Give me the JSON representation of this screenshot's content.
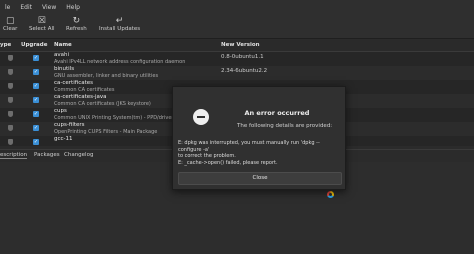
{
  "menubar": {
    "items": [
      "le",
      "Edit",
      "View",
      "Help"
    ]
  },
  "toolbar": {
    "clear_label": "Clear",
    "select_all_label": "Select All",
    "refresh_label": "Refresh",
    "install_label": "Install Updates"
  },
  "table": {
    "headers": {
      "type": "ype",
      "upgrade": "Upgrade",
      "name": "Name",
      "new_version": "New Version"
    },
    "rows": [
      {
        "name": "avahi",
        "desc": "Avahi IPv4LL network address configuration daemon",
        "version": "0.8-0ubuntu1.1"
      },
      {
        "name": "binutils",
        "desc": "GNU assembler, linker and binary utilities",
        "version": "2.34-6ubuntu2.2"
      },
      {
        "name": "ca-certificates",
        "desc": "Common CA certificates",
        "version": ""
      },
      {
        "name": "ca-certificates-java",
        "desc": "Common CA certificates (JKS keystore)",
        "version": ""
      },
      {
        "name": "cups",
        "desc": "Common UNIX Printing System(tm) - PPD/driver su",
        "version": ""
      },
      {
        "name": "cups-filters",
        "desc": "OpenPrinting CUPS Filters - Main Package",
        "version": ""
      },
      {
        "name": "gcc-11",
        "desc": "",
        "version": ""
      }
    ]
  },
  "bottom_tabs": {
    "description": "escription",
    "packages": "Packages",
    "changelog": "Changelog"
  },
  "dialog": {
    "title": "An error occurred",
    "subtitle": "The following details are provided:",
    "body_line1": "E: dpkg was interrupted, you must manually run 'dpkg --configure -a'",
    "body_line2": "to correct the problem.",
    "body_line3": "E: _cache->open() failed, please report.",
    "close_label": "Close"
  }
}
